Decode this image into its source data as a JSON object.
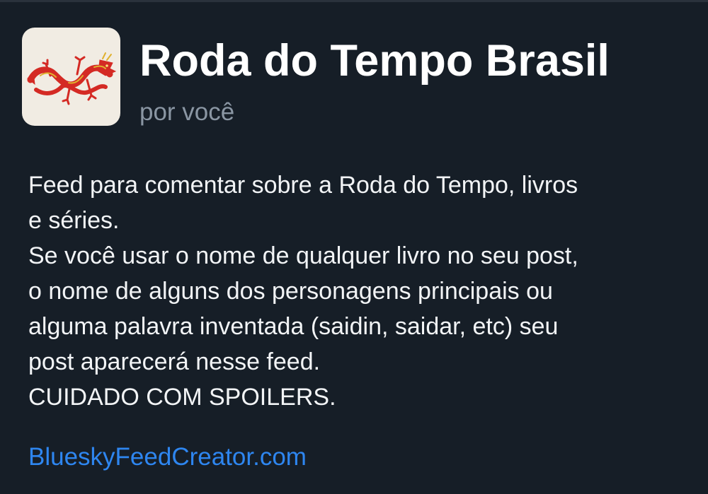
{
  "feed": {
    "title": "Roda do Tempo Brasil",
    "byline": "por você",
    "avatar_icon": "red-dragon-logo",
    "description_lines": [
      "Feed para comentar sobre a Roda do Tempo, livros",
      "e séries.",
      "Se você usar o nome de qualquer livro no seu post,",
      "o nome de alguns dos personagens principais ou",
      "alguma palavra inventada (saidin, saidar, etc) seu",
      "post aparecerá nesse feed.",
      "CUIDADO COM SPOILERS."
    ],
    "link_text": "BlueskyFeedCreator.com"
  },
  "colors": {
    "background": "#161e27",
    "title": "#ffffff",
    "byline": "#8a96a3",
    "body_text": "#f2f4f6",
    "link": "#2e86f0",
    "dragon_red": "#d42a24",
    "dragon_gold": "#e0b12e",
    "avatar_bg": "#f1ece3"
  }
}
